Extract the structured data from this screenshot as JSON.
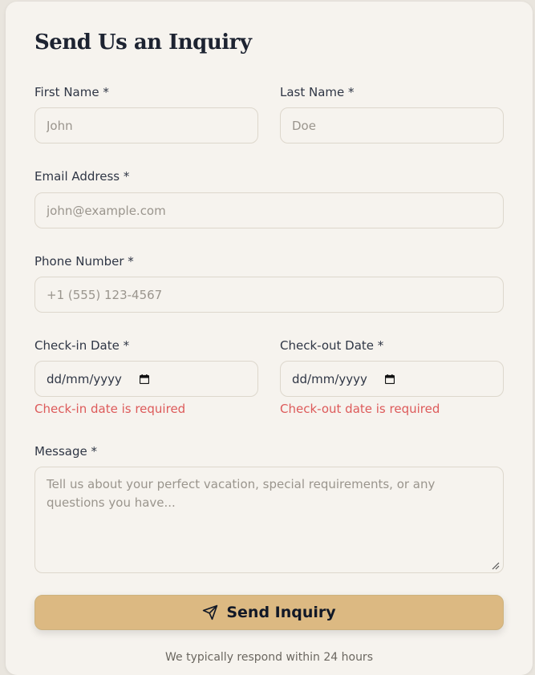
{
  "form": {
    "title": "Send Us an Inquiry",
    "first_name": {
      "label": "First Name *",
      "placeholder": "John"
    },
    "last_name": {
      "label": "Last Name *",
      "placeholder": "Doe"
    },
    "email": {
      "label": "Email Address *",
      "placeholder": "john@example.com"
    },
    "phone": {
      "label": "Phone Number *",
      "placeholder": "+1 (555) 123-4567"
    },
    "check_in": {
      "label": "Check-in Date *",
      "value": "dd/mm/yyyy",
      "error": "Check-in date is required"
    },
    "check_out": {
      "label": "Check-out Date *",
      "value": "dd/mm/yyyy",
      "error": "Check-out date is required"
    },
    "message": {
      "label": "Message *",
      "placeholder": "Tell us about your perfect vacation, special requirements, or any questions you have..."
    },
    "submit_label": "Send Inquiry",
    "footnote": "We typically respond within 24 hours"
  },
  "icons": {
    "calendar": "calendar-icon",
    "send": "paper-plane-icon",
    "resize": "resize-grip-icon"
  },
  "colors": {
    "accent": "#dcb982",
    "error": "#dd5a5a",
    "background": "#f6f3ee",
    "text": "#2f3645"
  }
}
